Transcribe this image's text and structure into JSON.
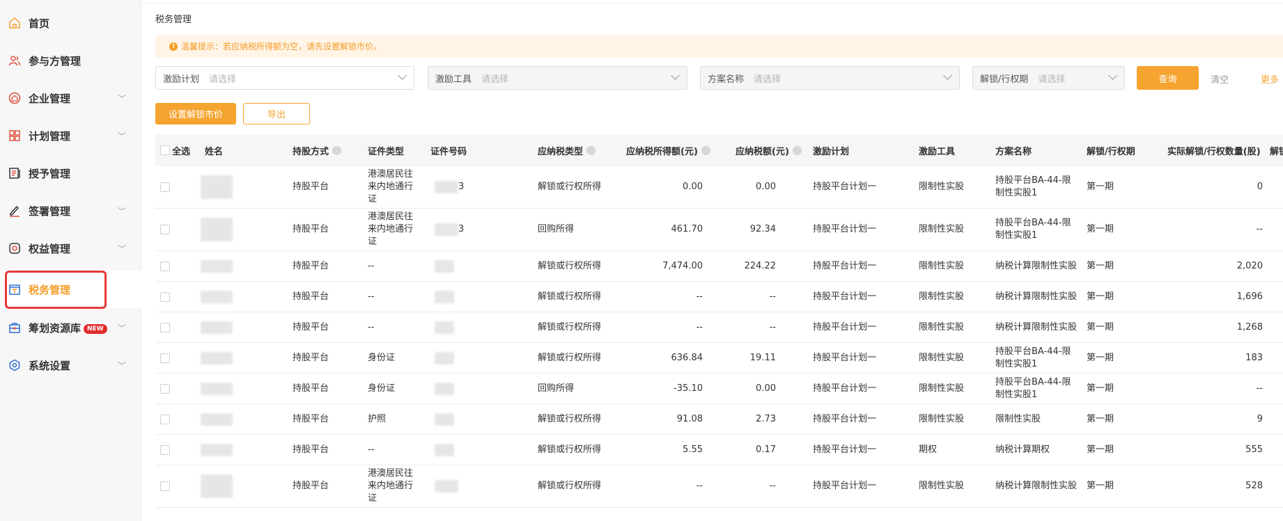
{
  "sidebar": {
    "items": [
      {
        "label": "首页",
        "icon": "home-icon",
        "chevron": false
      },
      {
        "label": "参与方管理",
        "icon": "users-icon",
        "chevron": false
      },
      {
        "label": "企业管理",
        "icon": "enterprise-icon",
        "chevron": true
      },
      {
        "label": "计划管理",
        "icon": "grid-icon",
        "chevron": true
      },
      {
        "label": "授予管理",
        "icon": "document-icon",
        "chevron": false
      },
      {
        "label": "签署管理",
        "icon": "signature-icon",
        "chevron": true
      },
      {
        "label": "权益管理",
        "icon": "equity-icon",
        "chevron": true
      },
      {
        "label": "税务管理",
        "icon": "tax-icon",
        "chevron": false,
        "active": true
      },
      {
        "label": "筹划资源库",
        "icon": "toolbox-icon",
        "chevron": true,
        "badge": "NEW"
      },
      {
        "label": "系统设置",
        "icon": "settings-icon",
        "chevron": true
      }
    ]
  },
  "page": {
    "title": "税务管理",
    "notice": "温馨提示：若应纳税所得额为空，请先设置解锁市价。"
  },
  "filters": [
    {
      "label": "激励计划",
      "placeholder": "请选择",
      "disabled": false
    },
    {
      "label": "激励工具",
      "placeholder": "请选择",
      "disabled": true
    },
    {
      "label": "方案名称",
      "placeholder": "请选择",
      "disabled": true
    },
    {
      "label": "解锁/行权期",
      "placeholder": "请选择",
      "disabled": true
    }
  ],
  "actions": {
    "query": "查询",
    "clear": "清空",
    "more": "更多",
    "set_price": "设置解锁市价",
    "export": "导出"
  },
  "table": {
    "select_all": "全选",
    "columns": [
      {
        "label": "姓名"
      },
      {
        "label": "持股方式",
        "info": true
      },
      {
        "label": "证件类型"
      },
      {
        "label": "证件号码"
      },
      {
        "label": "应纳税类型",
        "info": true
      },
      {
        "label": "应纳税所得额(元)",
        "info": true
      },
      {
        "label": "应纳税额(元)",
        "info": true
      },
      {
        "label": "激励计划"
      },
      {
        "label": "激励工具"
      },
      {
        "label": "方案名称"
      },
      {
        "label": "解锁/行权期"
      },
      {
        "label": "实际解锁/行权数量(股)"
      },
      {
        "label": "解锁"
      }
    ],
    "rows": [
      {
        "hold": "持股平台",
        "id_type": "港澳居民往来内地通行证",
        "id_no_tail": "3",
        "tax_type": "解锁或行权所得",
        "taxable": "0.00",
        "tax": "0.00",
        "plan": "持股平台计划一",
        "tool": "限制性实股",
        "scheme": "持股平台BA-44-限制性实股1",
        "period": "第一期",
        "qty": "0"
      },
      {
        "hold": "持股平台",
        "id_type": "港澳居民往来内地通行证",
        "id_no_tail": "3",
        "tax_type": "回购所得",
        "taxable": "461.70",
        "tax": "92.34",
        "plan": "持股平台计划一",
        "tool": "限制性实股",
        "scheme": "持股平台BA-44-限制性实股1",
        "period": "第一期",
        "qty": "--"
      },
      {
        "hold": "持股平台",
        "id_type": "--",
        "id_no_tail": "",
        "tax_type": "解锁或行权所得",
        "taxable": "7,474.00",
        "tax": "224.22",
        "plan": "持股平台计划一",
        "tool": "限制性实股",
        "scheme": "纳税计算限制性实股",
        "period": "第一期",
        "qty": "2,020"
      },
      {
        "hold": "持股平台",
        "id_type": "--",
        "id_no_tail": "",
        "tax_type": "解锁或行权所得",
        "taxable": "--",
        "tax": "--",
        "plan": "持股平台计划一",
        "tool": "限制性实股",
        "scheme": "纳税计算限制性实股",
        "period": "第一期",
        "qty": "1,696"
      },
      {
        "hold": "持股平台",
        "id_type": "--",
        "id_no_tail": "",
        "tax_type": "解锁或行权所得",
        "taxable": "--",
        "tax": "--",
        "plan": "持股平台计划一",
        "tool": "限制性实股",
        "scheme": "纳税计算限制性实股",
        "period": "第一期",
        "qty": "1,268"
      },
      {
        "hold": "持股平台",
        "id_type": "身份证",
        "id_no_tail": "",
        "tax_type": "解锁或行权所得",
        "taxable": "636.84",
        "tax": "19.11",
        "plan": "持股平台计划一",
        "tool": "限制性实股",
        "scheme": "持股平台BA-44-限制性实股1",
        "period": "第一期",
        "qty": "183"
      },
      {
        "hold": "持股平台",
        "id_type": "身份证",
        "id_no_tail": "",
        "tax_type": "回购所得",
        "taxable": "-35.10",
        "tax": "0.00",
        "plan": "持股平台计划一",
        "tool": "限制性实股",
        "scheme": "持股平台BA-44-限制性实股1",
        "period": "第一期",
        "qty": "--"
      },
      {
        "hold": "持股平台",
        "id_type": "护照",
        "id_no_tail": "",
        "tax_type": "解锁或行权所得",
        "taxable": "91.08",
        "tax": "2.73",
        "plan": "持股平台计划一",
        "tool": "限制性实股",
        "scheme": "限制性实股",
        "period": "第一期",
        "qty": "9"
      },
      {
        "hold": "持股平台",
        "id_type": "--",
        "id_no_tail": "",
        "tax_type": "解锁或行权所得",
        "taxable": "5.55",
        "tax": "0.17",
        "plan": "持股平台计划一",
        "tool": "期权",
        "scheme": "纳税计算期权",
        "period": "第一期",
        "qty": "555"
      },
      {
        "hold": "持股平台",
        "id_type": "港澳居民往来内地通行证",
        "id_no_tail": "",
        "tax_type": "解锁或行权所得",
        "taxable": "--",
        "tax": "--",
        "plan": "持股平台计划一",
        "tool": "限制性实股",
        "scheme": "纳税计算限制性实股",
        "period": "第一期",
        "qty": "528"
      }
    ]
  }
}
